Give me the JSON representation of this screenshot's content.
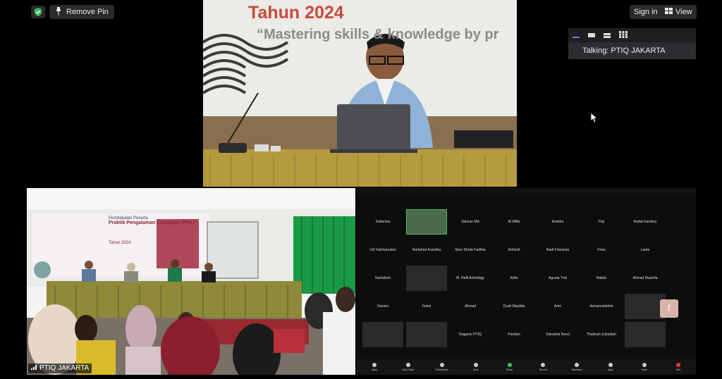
{
  "topbar": {
    "remove_pin_label": "Remove Pin",
    "sign_in_label": "Sign in",
    "view_label": "View"
  },
  "speaker_panel": {
    "talking_label": "Talking: PTIQ JAKARTA"
  },
  "main_video": {
    "banner_title": "Tahun 2024",
    "banner_subtitle": "“Mastering skills & knowledge by pr"
  },
  "room_video": {
    "banner_lines": [
      "Pembekalan Peserta",
      "Praktik Pengalaman Lapangan (PPL)",
      "Tahun 2024"
    ],
    "participant_name": "PTIQ JAKARTA"
  },
  "gallery": {
    "names": [
      "Sultanina",
      "",
      "Salman MA",
      "Al Mifta",
      "Ibrahim",
      "Fiqi",
      "Arafat Kambey",
      "LM Fahmanulani",
      "Nurfahmi Arandha",
      "Noor Shofa Fadhila",
      "Arifandi",
      "Nadi Firwanda",
      "Frian",
      "Laela",
      "Nutrisilahi",
      "",
      "M. Rafli Ashiddigy",
      "Arifin",
      "Agusta Trisi",
      "Nabila",
      "Ahmad Mustofa",
      "Nuraini",
      "Fairul",
      "Ahmad",
      "Dyah Maulida",
      "Amri",
      "Asmanudiahtin",
      "",
      "",
      "",
      "Ragams PTIQ",
      "Pardian",
      "Salsabila Nurul",
      "Thahirah Zubaidah",
      ""
    ],
    "toolbar": [
      "Mute",
      "Stop Video",
      "Participants",
      "Chat",
      "Share",
      "Record",
      "Reactions",
      "Apps",
      "More",
      "End"
    ]
  },
  "colors": {
    "accent_red": "#c94a3c",
    "active_green": "#3fbf5a",
    "green_curtain": "#1b9a45"
  },
  "icons": [
    "shield-icon",
    "pin-icon",
    "grid-icon",
    "cursor-icon",
    "mic-icon",
    "facebook-icon"
  ]
}
